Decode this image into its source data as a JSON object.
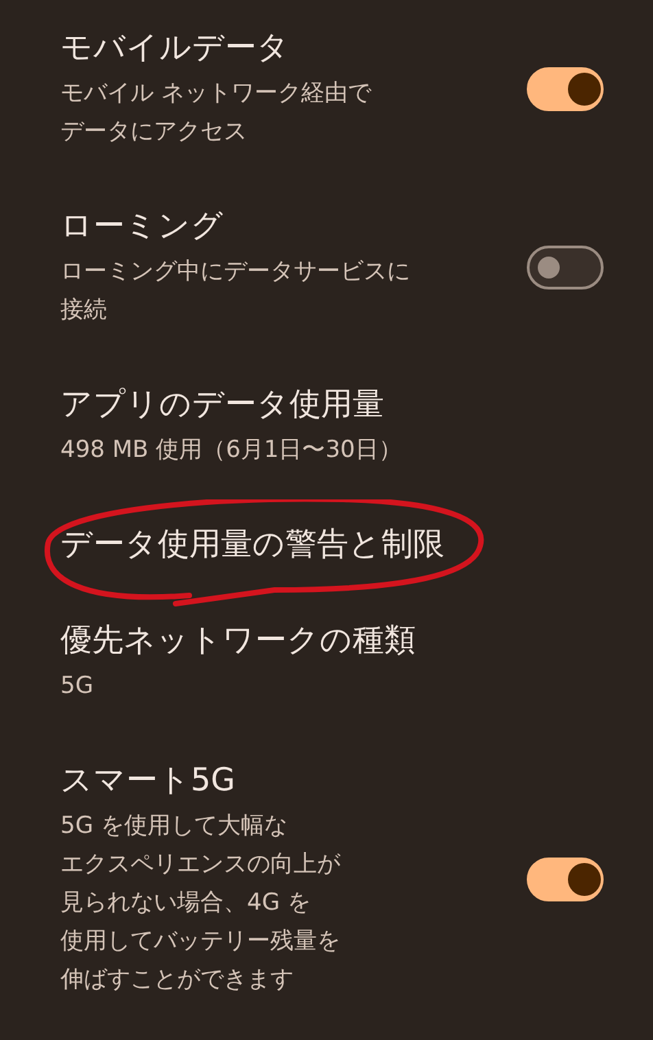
{
  "settings": [
    {
      "kind": "toggle",
      "title": "モバイルデータ",
      "subtitle_lines": [
        "モバイル ネットワーク経由で",
        "データにアクセス"
      ],
      "on": true
    },
    {
      "kind": "toggle",
      "title": "ローミング",
      "subtitle_lines": [
        "ローミング中にデータサービスに",
        "接続"
      ],
      "on": false
    },
    {
      "kind": "link",
      "title": "アプリのデータ使用量",
      "subtitle_lines": [
        "498 MB 使用（6月1日〜30日）"
      ]
    },
    {
      "kind": "link",
      "title": "データ使用量の警告と制限",
      "circled": true
    },
    {
      "kind": "link",
      "title": "優先ネットワークの種類",
      "subtitle_lines": [
        "5G"
      ]
    },
    {
      "kind": "toggle",
      "title": "スマート5G",
      "subtitle_lines": [
        "5G を使用して大幅な",
        "エクスペリエンスの向上が",
        "見られない場合、4G を",
        "使用してバッテリー残量を",
        "伸ばすことができます"
      ],
      "on": true
    }
  ]
}
